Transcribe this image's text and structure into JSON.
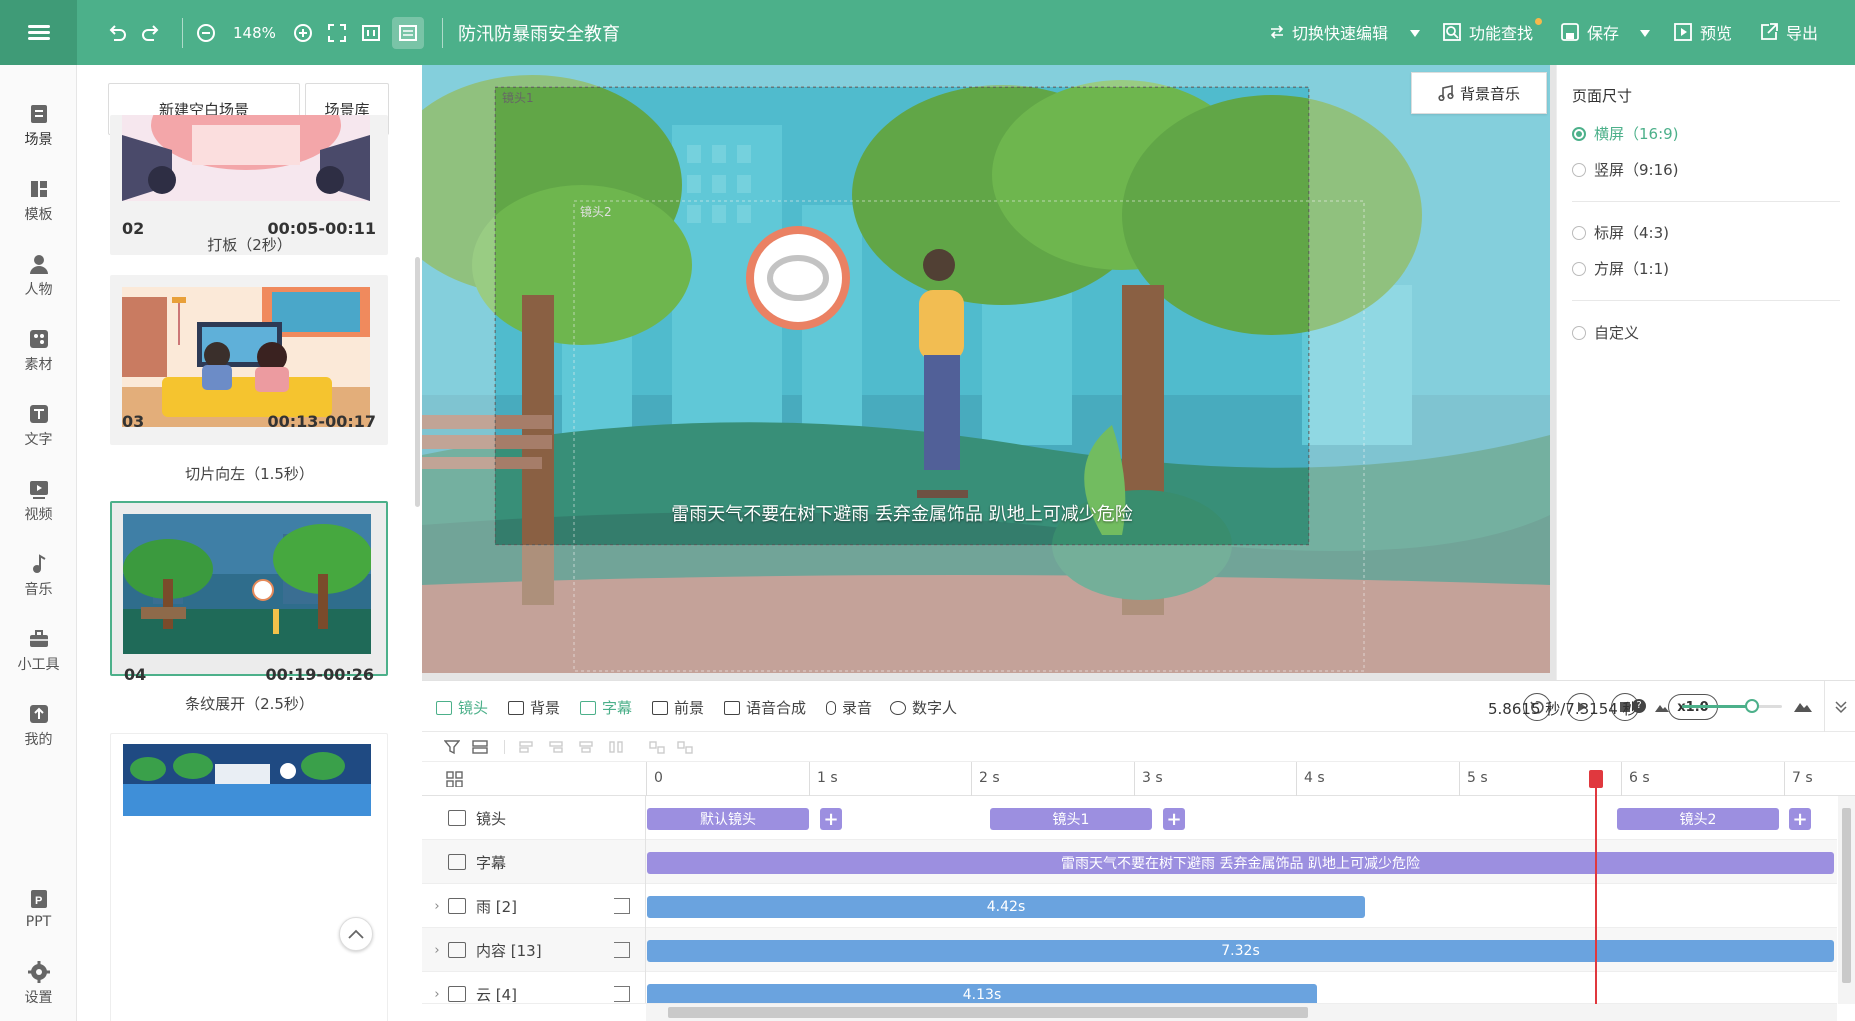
{
  "app": {
    "title": "防汛防暴雨安全教育",
    "zoom": "148%"
  },
  "toolbar": {
    "switch_edit": "切换快速编辑",
    "feature_search": "功能查找",
    "save": "保存",
    "preview": "预览",
    "export": "导出"
  },
  "nav": {
    "items": [
      {
        "label": "场景",
        "icon": "scene-icon"
      },
      {
        "label": "模板",
        "icon": "template-icon"
      },
      {
        "label": "人物",
        "icon": "person-icon"
      },
      {
        "label": "素材",
        "icon": "material-icon"
      },
      {
        "label": "文字",
        "icon": "text-icon"
      },
      {
        "label": "视频",
        "icon": "video-icon"
      },
      {
        "label": "音乐",
        "icon": "music-icon"
      },
      {
        "label": "小工具",
        "icon": "toolbox-icon"
      },
      {
        "label": "我的",
        "icon": "upload-icon"
      }
    ],
    "bottom": [
      {
        "label": "PPT",
        "icon": "ppt-icon"
      },
      {
        "label": "设置",
        "icon": "gear-icon"
      }
    ]
  },
  "scenes": {
    "new_blank": "新建空白场景",
    "library": "场景库",
    "cards": [
      {
        "num": "02",
        "time": "00:05-00:11",
        "transition": "打板（2秒）"
      },
      {
        "num": "03",
        "time": "00:13-00:17",
        "transition": "切片向左（1.5秒）"
      },
      {
        "num": "04",
        "time": "00:19-00:26",
        "transition": "条纹展开（2.5秒）"
      }
    ]
  },
  "stage": {
    "bgm_label": "背景音乐",
    "cam1_label": "镜头1",
    "cam2_label": "镜头2",
    "subtitle": "雷雨天气不要在树下避雨 丢弃金属饰品 趴地上可减少危险"
  },
  "page_size": {
    "title": "页面尺寸",
    "options": [
      {
        "label": "横屏（16:9)",
        "selected": true
      },
      {
        "label": "竖屏（9:16)",
        "selected": false
      },
      {
        "label": "标屏（4:3)",
        "selected": false
      },
      {
        "label": "方屏（1:1)",
        "selected": false
      },
      {
        "label": "自定义",
        "selected": false
      }
    ]
  },
  "timeline_tools": {
    "camera": "镜头",
    "background": "背景",
    "subtitle": "字幕",
    "foreground": "前景",
    "tts": "语音合成",
    "record": "录音",
    "digital_human": "数字人",
    "speed": "x1.0",
    "time_readout": "5.8615 秒/7.3154 秒",
    "zoom_level": 0.7
  },
  "ruler": [
    "0",
    "1 s",
    "2 s",
    "3 s",
    "4 s",
    "5 s",
    "6 s",
    "7 s"
  ],
  "tracks": {
    "camera": {
      "label": "镜头",
      "blocks": [
        "默认镜头",
        "镜头1",
        "镜头2"
      ]
    },
    "subtitle": {
      "label": "字幕",
      "text": "雷雨天气不要在树下避雨 丢弃金属饰品 趴地上可减少危险"
    },
    "rain": {
      "label": "雨 [2]",
      "duration": "4.42s"
    },
    "content": {
      "label": "内容 [13]",
      "duration": "7.32s"
    },
    "cloud": {
      "label": "云 [4]",
      "duration": "4.13s"
    }
  },
  "colors": {
    "brand": "#4cb08a",
    "playhead": "#e0383e",
    "camera_block": "#9c8fe0",
    "element_block": "#6aa3df"
  }
}
